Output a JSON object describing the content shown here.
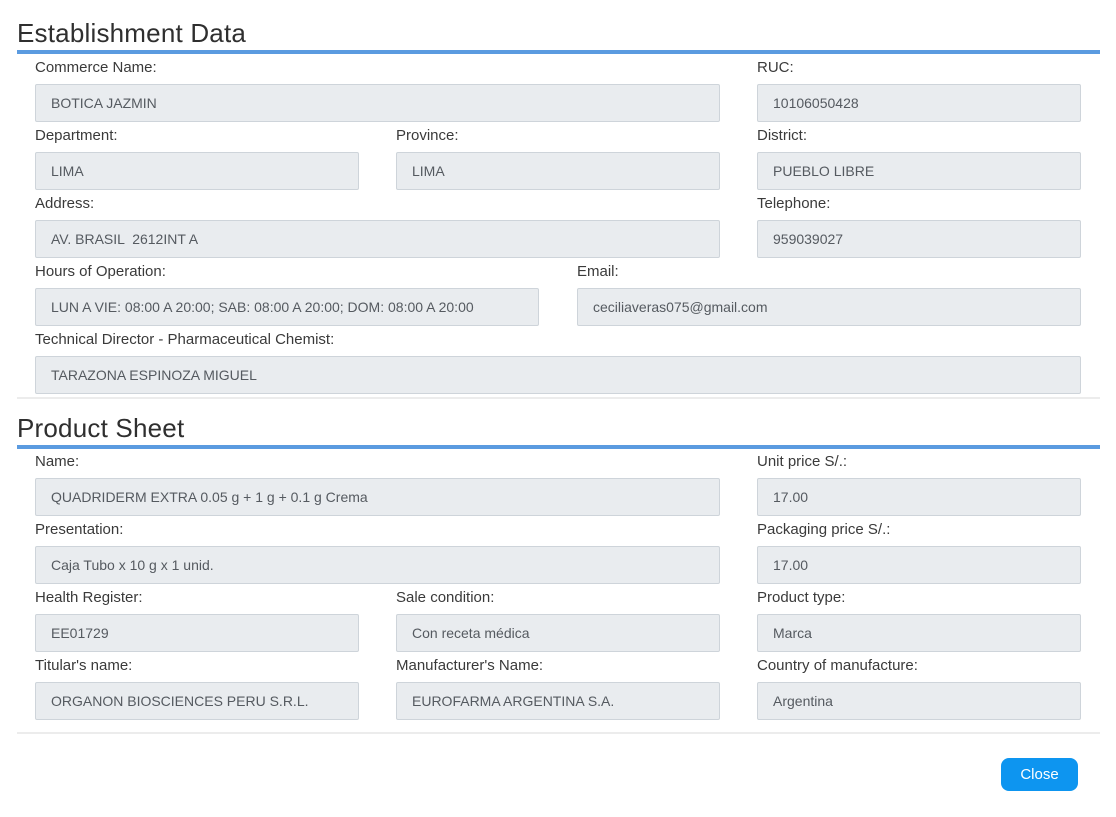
{
  "establishment": {
    "title": "Establishment Data",
    "commerce_name": {
      "label": "Commerce Name:",
      "value": "BOTICA JAZMIN"
    },
    "ruc": {
      "label": "RUC:",
      "value": "10106050428"
    },
    "department": {
      "label": "Department:",
      "value": "LIMA"
    },
    "province": {
      "label": "Province:",
      "value": "LIMA"
    },
    "district": {
      "label": "District:",
      "value": "PUEBLO LIBRE"
    },
    "address": {
      "label": "Address:",
      "value": "AV. BRASIL  2612INT A"
    },
    "telephone": {
      "label": "Telephone:",
      "value": "959039027"
    },
    "hours": {
      "label": "Hours of Operation:",
      "value": "LUN A VIE: 08:00 A 20:00; SAB: 08:00 A 20:00; DOM: 08:00 A 20:00"
    },
    "email": {
      "label": "Email:",
      "value": "ceciliaveras075@gmail.com"
    },
    "technical_director": {
      "label": "Technical Director - Pharmaceutical Chemist:",
      "value": "TARAZONA ESPINOZA MIGUEL"
    }
  },
  "product": {
    "title": "Product Sheet",
    "name": {
      "label": "Name:",
      "value": "QUADRIDERM EXTRA 0.05 g + 1 g + 0.1 g Crema"
    },
    "unit_price": {
      "label": "Unit price S/.:",
      "value": "17.00"
    },
    "presentation": {
      "label": "Presentation:",
      "value": "Caja Tubo x 10 g x 1 unid."
    },
    "packaging_price": {
      "label": "Packaging price S/.:",
      "value": "17.00"
    },
    "health_register": {
      "label": "Health Register:",
      "value": "EE01729"
    },
    "sale_condition": {
      "label": "Sale condition:",
      "value": "Con receta médica"
    },
    "product_type": {
      "label": "Product type:",
      "value": "Marca"
    },
    "titular_name": {
      "label": "Titular's name:",
      "value": "ORGANON BIOSCIENCES PERU S.R.L."
    },
    "manufacturer_name": {
      "label": "Manufacturer's Name:",
      "value": "EUROFARMA ARGENTINA S.A."
    },
    "country": {
      "label": "Country of manufacture:",
      "value": "Argentina"
    }
  },
  "footer": {
    "close_label": "Close"
  },
  "colors": {
    "accent_bar": "#5b9be0",
    "button": "#0d95f0",
    "input_bg": "#e9ecef"
  }
}
